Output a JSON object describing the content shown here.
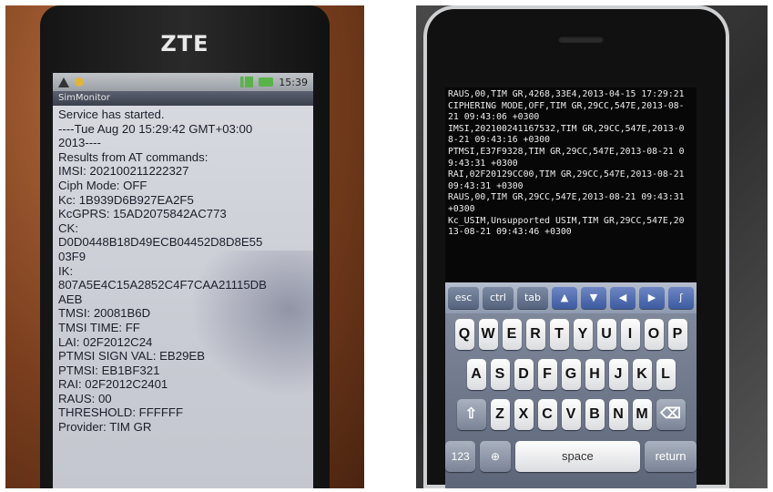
{
  "left_photo": {
    "brand": "ZTE",
    "status_time": "15:39",
    "app_title": "SimMonitor",
    "lines": [
      "Service has started.",
      "----Tue Aug 20 15:29:42 GMT+03:00",
      "2013----",
      "Results from AT commands:",
      "IMSI: 202100211222327",
      "Ciph Mode: OFF",
      "Kc: 1B939D6B927EA2F5",
      "KcGPRS: 15AD2075842AC773",
      "CK:",
      "D0D0448B18D49ECB04452D8D8E55",
      "03F9",
      "IK:",
      "807A5E4C15A2852C4F7CAA21115DB",
      "AEB",
      "TMSI: 20081B6D",
      "TMSI TIME: FF",
      "LAI: 02F2012C24",
      "PTMSI SIGN VAL: EB29EB",
      "PTMSI: EB1BF321",
      "RAI: 02F2012C2401",
      "RAUS: 00",
      "THRESHOLD: FFFFFF",
      "Provider: TIM GR"
    ]
  },
  "right_photo": {
    "terminal_lines": [
      "RAUS,00,TIM GR,4268,33E4,2013-04-15 17:29:21",
      "CIPHERING MODE,OFF,TIM GR,29CC,547E,2013-08-",
      "21 09:43:06 +0300",
      "IMSI,202100241167532,TIM GR,29CC,547E,2013-0",
      "8-21 09:43:16 +0300",
      "PTMSI,E37F9328,TIM GR,29CC,547E,2013-08-21 0",
      "9:43:31 +0300",
      "RAI,02F20129CC00,TIM GR,29CC,547E,2013-08-21",
      " 09:43:31 +0300",
      "RAUS,00,TIM GR,29CC,547E,2013-08-21 09:43:31",
      " +0300",
      "Kc_USIM,Unsupported USIM,TIM GR,29CC,547E,20",
      "13-08-21 09:43:46 +0300"
    ],
    "toolbar": {
      "esc": "esc",
      "ctrl": "ctrl",
      "tab": "tab",
      "up": "▲",
      "down": "▼",
      "left": "◀",
      "right": "▶",
      "fn": "ʃ"
    },
    "keyboard": {
      "row1": [
        "Q",
        "W",
        "E",
        "R",
        "T",
        "Y",
        "U",
        "I",
        "O",
        "P"
      ],
      "row2": [
        "A",
        "S",
        "D",
        "F",
        "G",
        "H",
        "J",
        "K",
        "L"
      ],
      "row3": [
        "Z",
        "X",
        "C",
        "V",
        "B",
        "N",
        "M"
      ],
      "numbers_label": "123",
      "space_label": "space",
      "return_label": "return"
    }
  }
}
